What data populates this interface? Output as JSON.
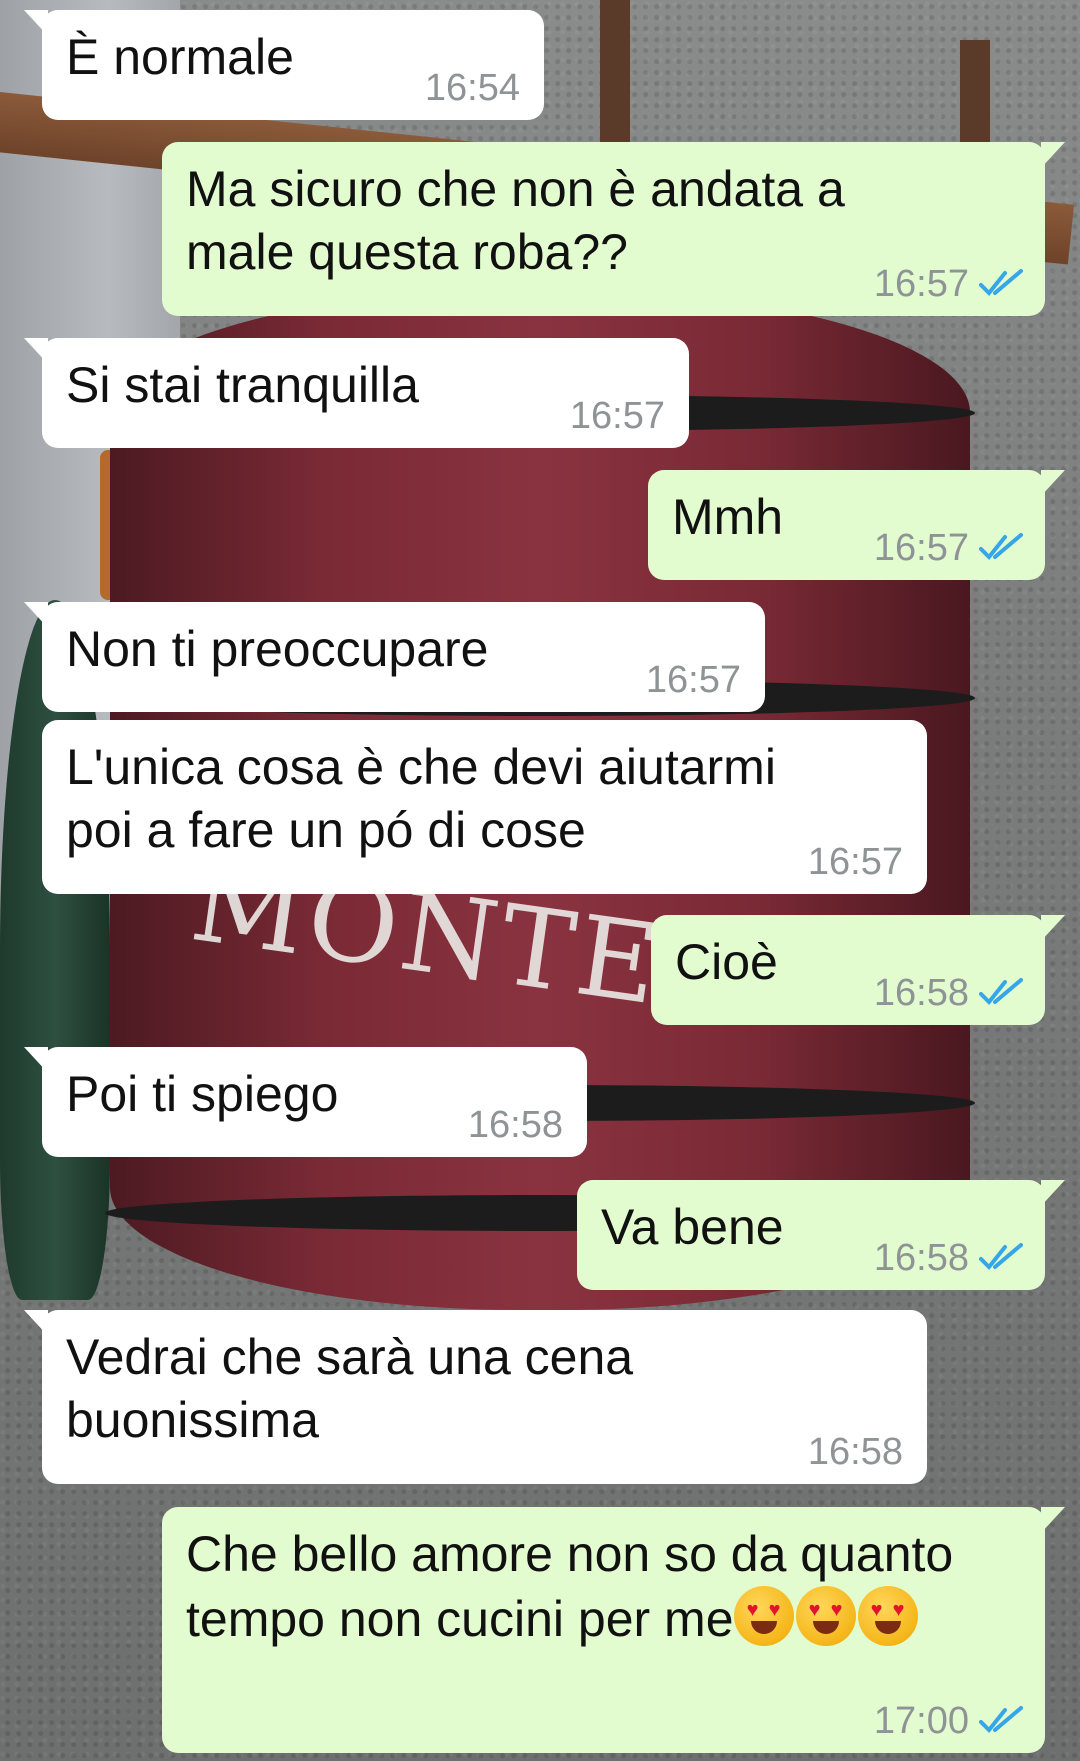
{
  "colors": {
    "incoming": "#ffffff",
    "outgoing": "#e2fbcf",
    "read_ticks": "#35a6e8",
    "time": "#8e9396"
  },
  "background": {
    "barrel_lettering": "MONTEPA"
  },
  "messages": [
    {
      "dir": "in",
      "lines": [
        "È normale"
      ],
      "time": "16:54"
    },
    {
      "dir": "out",
      "lines": [
        "Ma sicuro che non è andata a",
        "male questa roba??"
      ],
      "time": "16:57",
      "status": "read"
    },
    {
      "dir": "in",
      "lines": [
        "Si stai tranquilla"
      ],
      "time": "16:57"
    },
    {
      "dir": "out",
      "lines": [
        "Mmh"
      ],
      "time": "16:57",
      "status": "read"
    },
    {
      "dir": "in",
      "lines": [
        "Non ti preoccupare"
      ],
      "time": "16:57"
    },
    {
      "dir": "in",
      "lines": [
        "L'unica cosa è che devi aiutarmi",
        "poi a fare un pó di cose"
      ],
      "time": "16:57"
    },
    {
      "dir": "out",
      "lines": [
        "Cioè"
      ],
      "time": "16:58",
      "status": "read"
    },
    {
      "dir": "in",
      "lines": [
        "Poi ti spiego"
      ],
      "time": "16:58"
    },
    {
      "dir": "out",
      "lines": [
        "Va bene"
      ],
      "time": "16:58",
      "status": "read"
    },
    {
      "dir": "in",
      "lines": [
        "Vedrai che sarà una cena",
        "buonissima"
      ],
      "time": "16:58"
    },
    {
      "dir": "out",
      "lines": [
        "Che bello amore non so da quanto",
        "tempo non cucini per me"
      ],
      "emoji": [
        "heart-eyes-emoji",
        "heart-eyes-emoji",
        "heart-eyes-emoji"
      ],
      "time": "17:00",
      "status": "read"
    }
  ]
}
